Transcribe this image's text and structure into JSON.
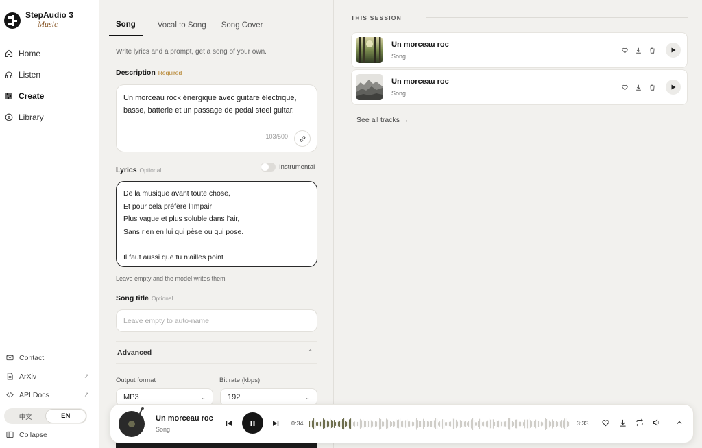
{
  "app": {
    "name": "StepAudio 3",
    "sub": "Music"
  },
  "nav": [
    {
      "label": "Home",
      "icon": "home-icon"
    },
    {
      "label": "Listen",
      "icon": "headphones-icon"
    },
    {
      "label": "Create",
      "icon": "sliders-icon",
      "active": true
    },
    {
      "label": "Library",
      "icon": "disc-icon"
    }
  ],
  "links": [
    {
      "label": "Contact",
      "icon": "mail-icon"
    },
    {
      "label": "ArXiv",
      "icon": "doc-icon",
      "external": "↗"
    },
    {
      "label": "API Docs",
      "icon": "code-icon",
      "external": "↗"
    }
  ],
  "lang": {
    "zh": "中文",
    "en": "EN"
  },
  "collapse_label": "Collapse",
  "tabs": [
    "Song",
    "Vocal to Song",
    "Song Cover"
  ],
  "form": {
    "hint": "Write lyrics and a prompt, get a song of your own.",
    "description_label": "Description",
    "description_required": "Required",
    "description_text": "Un morceau rock énergique avec guitare électrique, basse, batterie et un passage de pedal steel guitar.",
    "description_count": "103/500",
    "lyrics_label": "Lyrics",
    "lyrics_optional": "Optional",
    "instrumental_label": "Instrumental",
    "lyrics_lines": [
      "De la musique avant toute chose,",
      "Et pour cela préfère l’Impair",
      "Plus vague et plus soluble dans l’air,",
      "Sans rien en lui qui pèse ou qui pose.",
      "",
      "Il faut aussi que tu n’ailles point"
    ],
    "lyrics_note": "Leave empty and the model writes them",
    "title_label": "Song title",
    "title_optional": "Optional",
    "title_placeholder": "Leave empty to auto-name",
    "advanced_label": "Advanced",
    "output_format_label": "Output format",
    "output_format_value": "MP3",
    "bitrate_label": "Bit rate (kbps)",
    "bitrate_value": "192"
  },
  "session": {
    "header": "THIS SESSION",
    "tracks": [
      {
        "title": "Un morceau roc",
        "sub": "Song"
      },
      {
        "title": "Un morceau roc",
        "sub": "Song"
      }
    ],
    "see_all": "See all tracks →"
  },
  "player": {
    "title": "Un morceau roc",
    "sub": "Song",
    "elapsed": "0:34",
    "duration": "3:33",
    "progress": 0.16
  },
  "colors": {
    "accent": "#161616",
    "required": "#b07a1d",
    "wave_played": "#6f6f4f",
    "wave_rest": "#cfcdc8"
  }
}
